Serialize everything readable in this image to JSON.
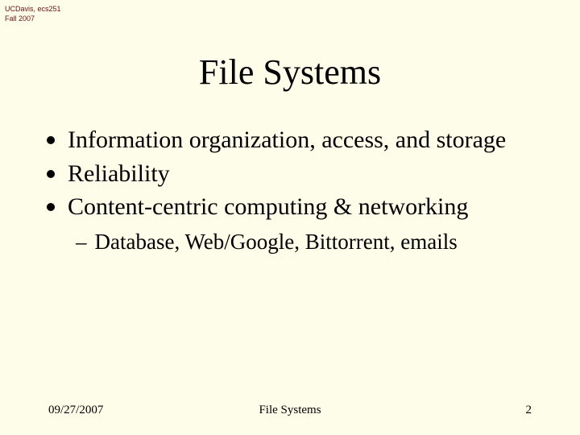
{
  "header": {
    "line1": "UCDavis, ecs251",
    "line2": "Fall 2007"
  },
  "title": "File Systems",
  "bullets": {
    "b1": "Information organization, access, and storage",
    "b2": "Reliability",
    "b3": "Content-centric computing & networking"
  },
  "sub": {
    "s1": "Database, Web/Google, Bittorrent, emails"
  },
  "footer": {
    "date": "09/27/2007",
    "topic": "File Systems",
    "page": "2"
  }
}
